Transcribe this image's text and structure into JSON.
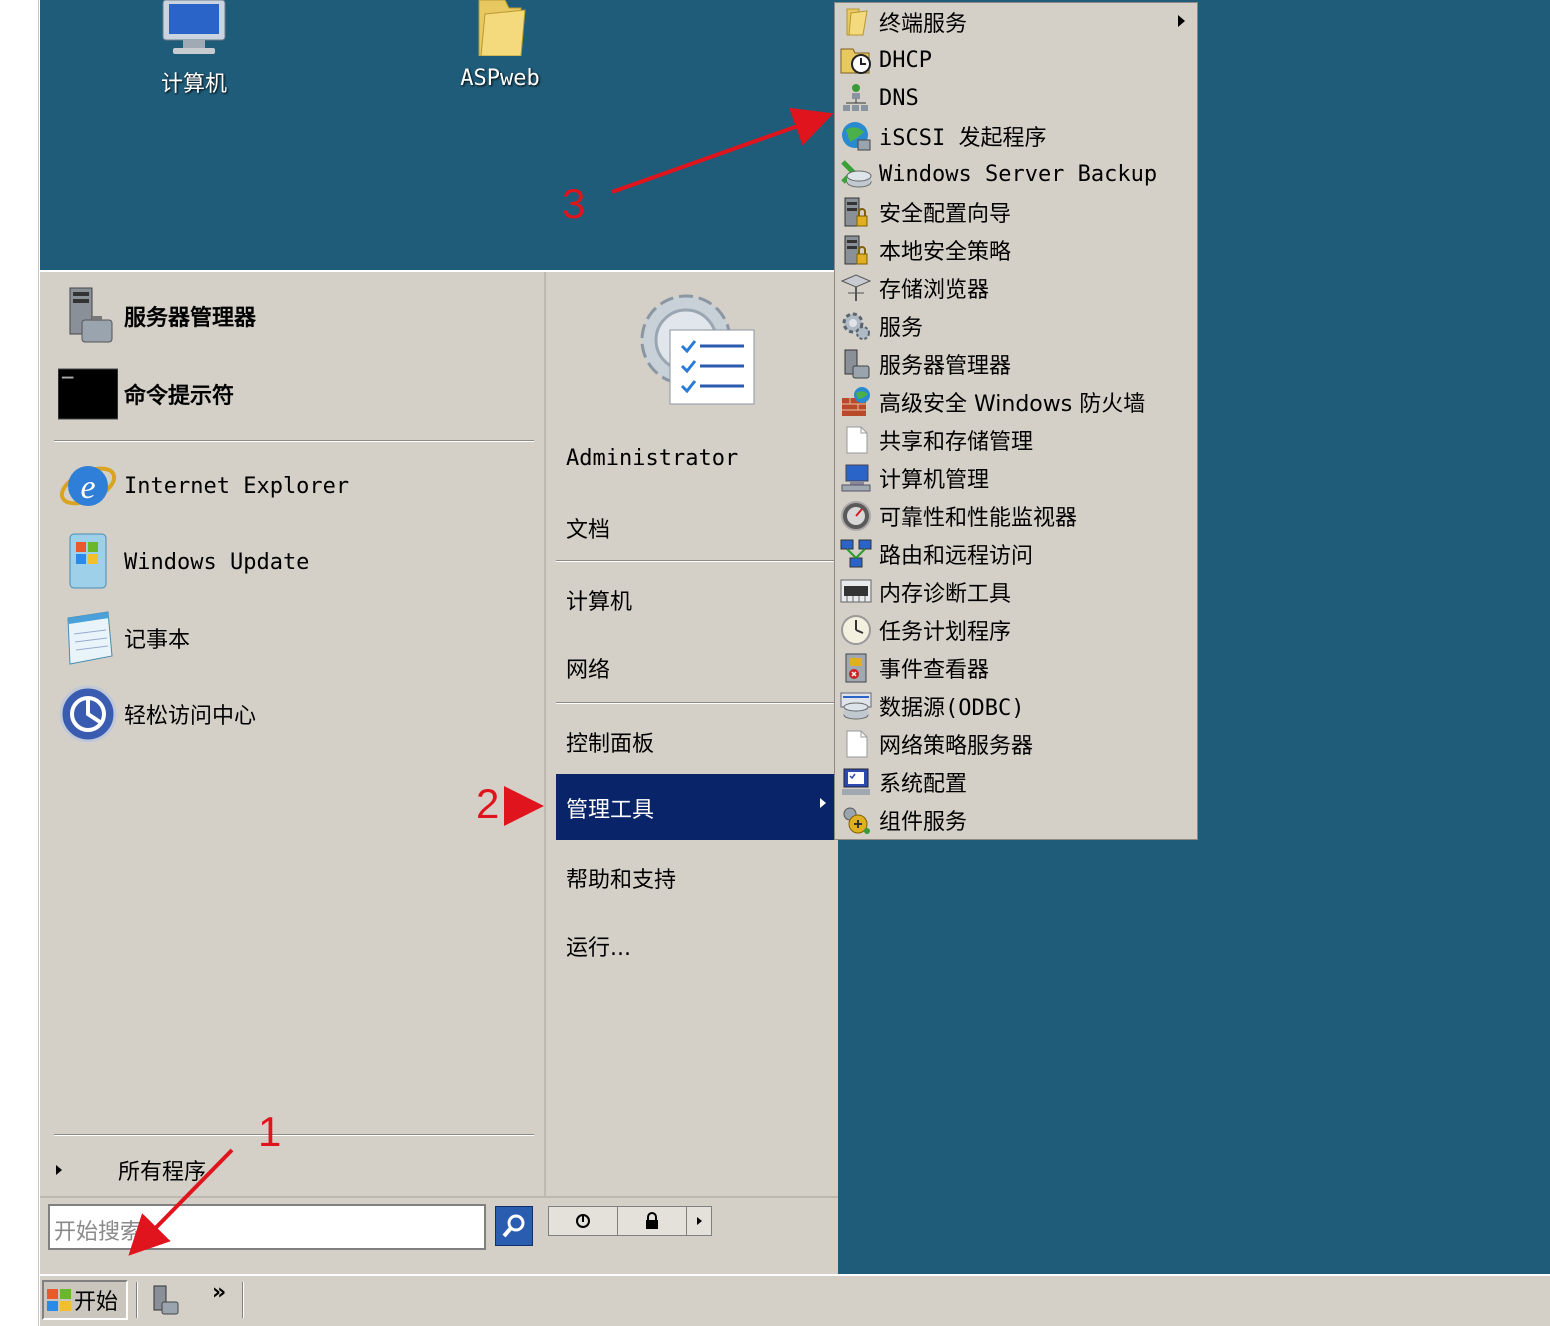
{
  "desktop": {
    "icons": [
      {
        "label": "计算机",
        "icon": "computer-icon"
      },
      {
        "label": "ASPweb",
        "icon": "folder-icon"
      }
    ]
  },
  "start_menu": {
    "pinned": [
      {
        "label": "服务器管理器",
        "icon": "server-manager-icon"
      },
      {
        "label": "命令提示符",
        "icon": "command-prompt-icon"
      }
    ],
    "recent": [
      {
        "label": "Internet Explorer",
        "icon": "internet-explorer-icon"
      },
      {
        "label": "Windows Update",
        "icon": "windows-update-icon"
      },
      {
        "label": "记事本",
        "icon": "notepad-icon"
      },
      {
        "label": "轻松访问中心",
        "icon": "ease-of-access-icon"
      }
    ],
    "all_programs": "所有程序",
    "search_placeholder": "开始搜索",
    "right": {
      "user": "Administrator",
      "documents": "文档",
      "computer": "计算机",
      "network": "网络",
      "control_panel": "控制面板",
      "admin_tools": "管理工具",
      "help": "帮助和支持",
      "run": "运行..."
    }
  },
  "admin_tools_menu": [
    {
      "label": "终端服务",
      "icon": "folder-icon",
      "submenu": true
    },
    {
      "label": "DHCP",
      "icon": "dhcp-icon"
    },
    {
      "label": "DNS",
      "icon": "dns-icon"
    },
    {
      "label": "iSCSI 发起程序",
      "icon": "iscsi-icon"
    },
    {
      "label": "Windows Server Backup",
      "icon": "backup-icon"
    },
    {
      "label": "安全配置向导",
      "icon": "security-wizard-icon"
    },
    {
      "label": "本地安全策略",
      "icon": "local-security-icon"
    },
    {
      "label": "存储浏览器",
      "icon": "storage-explorer-icon"
    },
    {
      "label": "服务",
      "icon": "services-icon"
    },
    {
      "label": "服务器管理器",
      "icon": "server-manager-icon"
    },
    {
      "label": "高级安全 Windows 防火墙",
      "icon": "firewall-icon"
    },
    {
      "label": "共享和存储管理",
      "icon": "share-storage-icon"
    },
    {
      "label": "计算机管理",
      "icon": "computer-management-icon"
    },
    {
      "label": "可靠性和性能监视器",
      "icon": "performance-monitor-icon"
    },
    {
      "label": "路由和远程访问",
      "icon": "routing-icon"
    },
    {
      "label": "内存诊断工具",
      "icon": "memory-diagnostic-icon"
    },
    {
      "label": "任务计划程序",
      "icon": "task-scheduler-icon"
    },
    {
      "label": "事件查看器",
      "icon": "event-viewer-icon"
    },
    {
      "label": "数据源(ODBC)",
      "icon": "odbc-icon"
    },
    {
      "label": "网络策略服务器",
      "icon": "nps-icon"
    },
    {
      "label": "系统配置",
      "icon": "system-config-icon"
    },
    {
      "label": "组件服务",
      "icon": "component-services-icon"
    }
  ],
  "taskbar": {
    "start_label": "开始",
    "overflow": "»"
  },
  "annotations": [
    "1",
    "2",
    "3"
  ],
  "colors": {
    "desktop": "#1f5c7a",
    "menu": "#d4d0c8",
    "highlight": "#0a246a",
    "annotation": "#e0141c"
  }
}
